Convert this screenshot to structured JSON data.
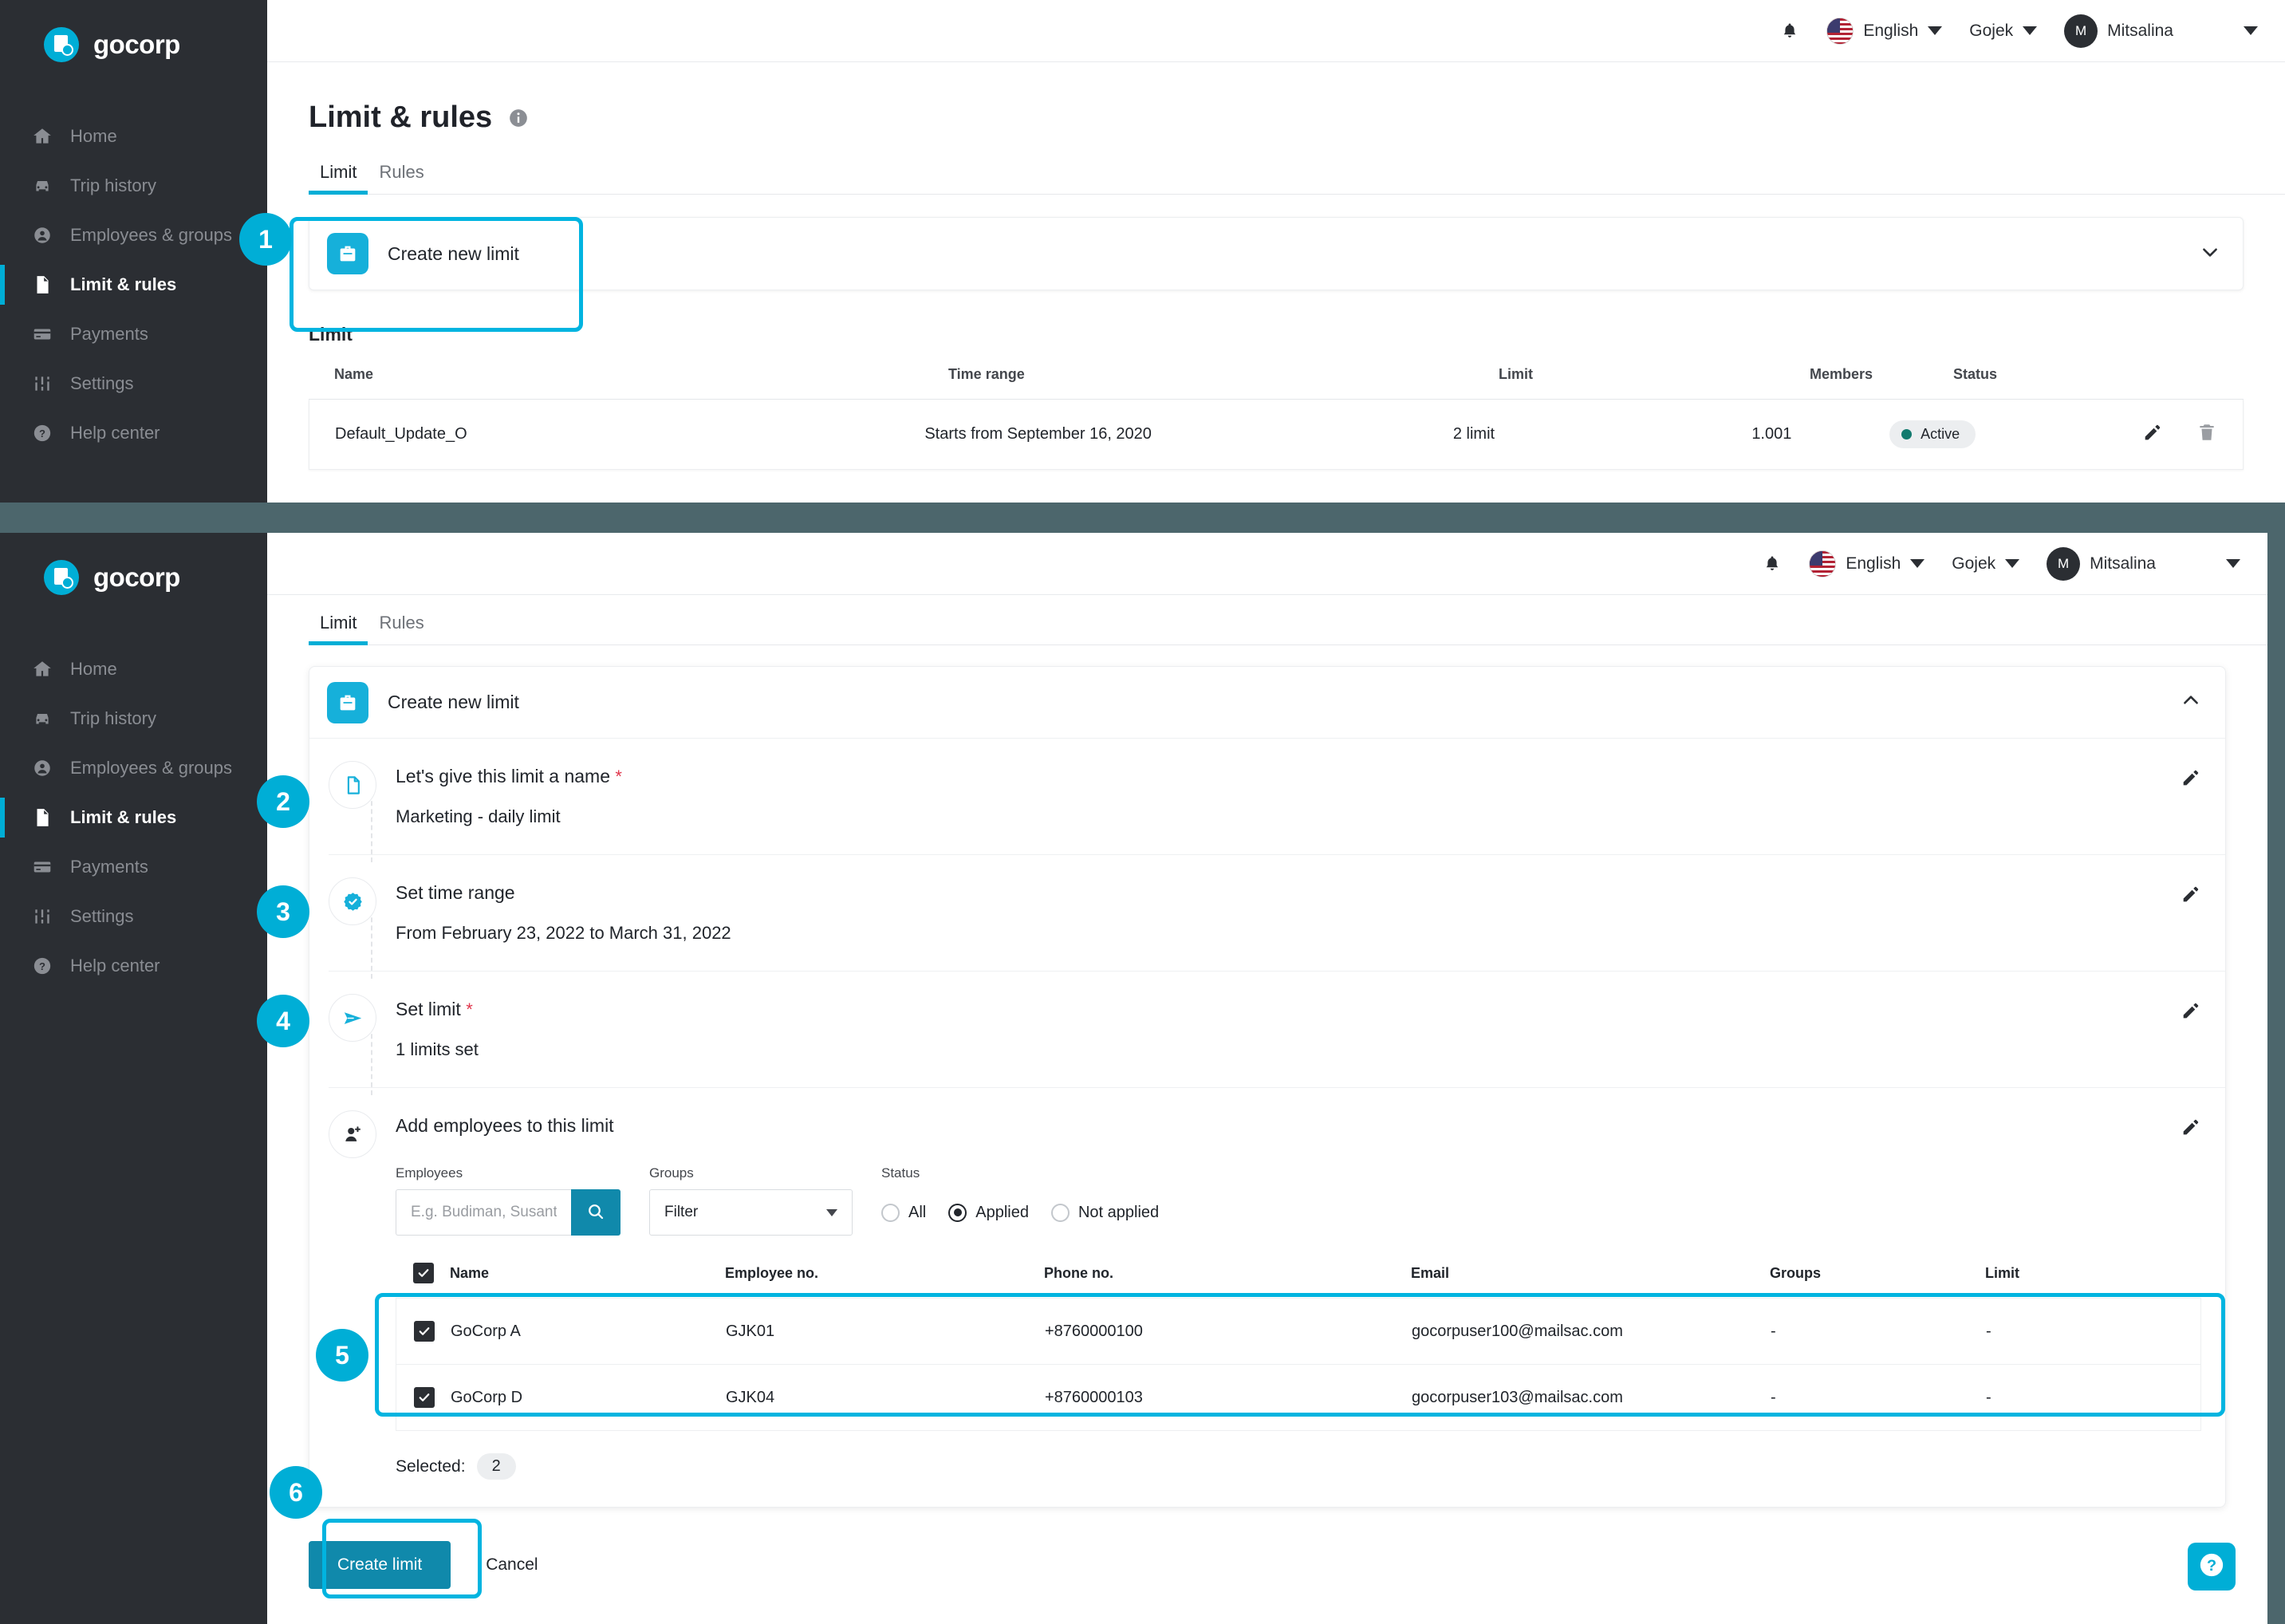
{
  "brand": {
    "name": "gocorp"
  },
  "sidebar": {
    "items": [
      {
        "label": "Home",
        "icon": "home-icon",
        "active": false
      },
      {
        "label": "Trip history",
        "icon": "car-icon",
        "active": false
      },
      {
        "label": "Employees & groups",
        "icon": "user-circle-icon",
        "active": false
      },
      {
        "label": "Limit & rules",
        "icon": "document-icon",
        "active": true
      },
      {
        "label": "Payments",
        "icon": "credit-card-icon",
        "active": false
      },
      {
        "label": "Settings",
        "icon": "sliders-icon",
        "active": false
      },
      {
        "label": "Help center",
        "icon": "question-circle-icon",
        "active": false
      }
    ]
  },
  "topbar": {
    "language": "English",
    "company": "Gojek",
    "user_initial": "M",
    "user_name": "Mitsalina"
  },
  "page": {
    "title": "Limit & rules",
    "tabs": [
      {
        "label": "Limit",
        "active": true
      },
      {
        "label": "Rules",
        "active": false
      }
    ]
  },
  "top_panel": {
    "create_card_label": "Create new limit",
    "section_label": "Limit",
    "table": {
      "columns": [
        "Name",
        "Time range",
        "Limit",
        "Members",
        "Status"
      ],
      "rows": [
        {
          "name": "Default_Update_O",
          "time_range": "Starts from September 16, 2020",
          "limit": "2 limit",
          "members": "1.001",
          "status": "Active"
        }
      ]
    }
  },
  "bottom_panel": {
    "create_card_label": "Create new limit",
    "steps": [
      {
        "title": "Let's give this limit a name",
        "required": true,
        "value": "Marketing - daily limit",
        "icon": "document-outline-icon"
      },
      {
        "title": "Set time range",
        "required": false,
        "value": "From February 23, 2022 to March 31, 2022",
        "icon": "check-badge-icon"
      },
      {
        "title": "Set limit",
        "required": true,
        "value": "1 limits set",
        "icon": "send-icon"
      },
      {
        "title": "Add employees to this limit",
        "required": false,
        "value": "",
        "icon": "add-user-icon"
      }
    ],
    "filters": {
      "employees_label": "Employees",
      "employees_placeholder": "E.g. Budiman, Susanti",
      "employees_value": "",
      "groups_label": "Groups",
      "groups_value": "Filter",
      "status_label": "Status",
      "status_options": [
        {
          "label": "All",
          "selected": false
        },
        {
          "label": "Applied",
          "selected": true
        },
        {
          "label": "Not applied",
          "selected": false
        }
      ]
    },
    "employee_table": {
      "columns": [
        "Name",
        "Employee no.",
        "Phone no.",
        "Email",
        "Groups",
        "Limit"
      ],
      "rows": [
        {
          "checked": true,
          "name": "GoCorp A",
          "employee_no": "GJK01",
          "phone": "+8760000100",
          "email": "gocorpuser100@mailsac.com",
          "groups": "-",
          "limit": "-"
        },
        {
          "checked": true,
          "name": "GoCorp D",
          "employee_no": "GJK04",
          "phone": "+8760000103",
          "email": "gocorpuser103@mailsac.com",
          "groups": "-",
          "limit": "-"
        }
      ]
    },
    "selected_label": "Selected:",
    "selected_count": "2",
    "create_button": "Create limit",
    "cancel_button": "Cancel"
  },
  "annotations": [
    {
      "number": "1"
    },
    {
      "number": "2"
    },
    {
      "number": "3"
    },
    {
      "number": "4"
    },
    {
      "number": "5"
    },
    {
      "number": "6"
    }
  ],
  "colors": {
    "accent": "#00aed6",
    "accent_dark": "#1089ab",
    "sidebar_bg": "#2b2e33",
    "band": "#4c666c",
    "status_active": "#127a6e",
    "required": "#e0364c"
  }
}
